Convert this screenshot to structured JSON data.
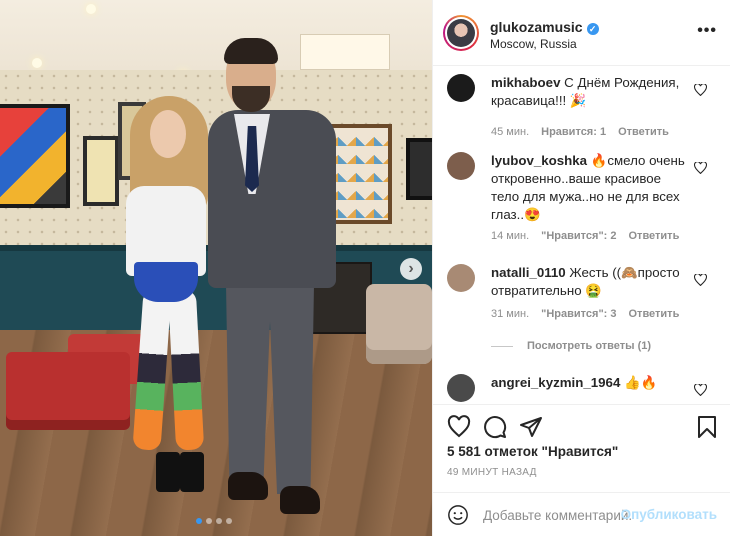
{
  "post": {
    "username": "glukozamusic",
    "location": "Moscow, Russia",
    "more_label": "•••"
  },
  "comments": [
    {
      "username": "mikhaboev",
      "text": "С Днём Рождения, красавица!!! 🎉",
      "time": "45 мин.",
      "likes": "Нравится: 1",
      "reply": "Ответить",
      "avatar_color": "#1b1b1b"
    },
    {
      "username": "lyubov_koshka",
      "text": "🔥смело очень откровенно..ваше красивое тело для мужа..но не для всех глаз..😍",
      "time": "14 мин.",
      "likes": "\"Нравится\": 2",
      "reply": "Ответить",
      "avatar_color": "#7d5e4c"
    },
    {
      "username": "natalli_0110",
      "text": "Жесть ((🙈просто отвратительно 🤮",
      "time": "31 мин.",
      "likes": "\"Нравится\": 3",
      "reply": "Ответить",
      "avatar_color": "#a88a74"
    },
    {
      "username": "angrei_kyzmin_1964",
      "text": "👍🔥",
      "avatar_color": "#4a4a4a"
    }
  ],
  "replies_label": "Посмотреть ответы (1)",
  "likes_count": "5 581 отметок \"Нравится\"",
  "time_ago": "49 МИНУТ НАЗАД",
  "comment_placeholder": "Добавьте комментарий...",
  "publish_label": "Опубликовать",
  "carousel": {
    "next_label": "›",
    "slides": 4,
    "active_slide": 1
  },
  "colors": {
    "accent": "#3897f0",
    "publish_disabled": "#b2dffc",
    "meta_gray": "#8e8e8e",
    "text": "#262626"
  },
  "icons": [
    "heart-icon",
    "comment-icon",
    "share-icon",
    "bookmark-icon",
    "emoji-icon",
    "verified-icon",
    "more-icon",
    "chevron-right-icon"
  ]
}
